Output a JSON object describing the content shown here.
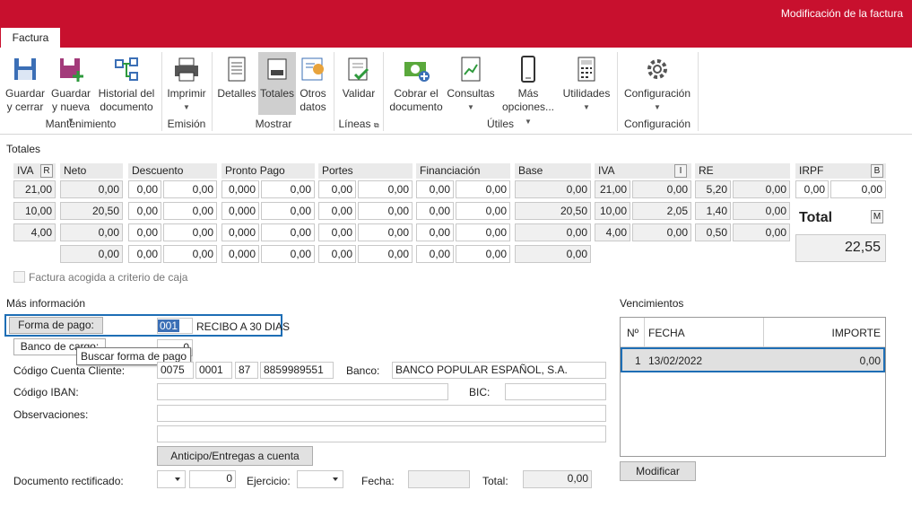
{
  "window": {
    "title": "Modificación de la factura",
    "tab": "Factura"
  },
  "ribbon": {
    "guardar": "Guardar\ny cerrar",
    "guardar_nueva": "Guardar\ny nueva",
    "historial": "Historial del\ndocumento",
    "imprimir": "Imprimir",
    "detalles": "Detalles",
    "totales": "Totales",
    "otros": "Otros\ndatos",
    "validar": "Validar",
    "cobrar": "Cobrar el\ndocumento",
    "consultas": "Consultas",
    "mas": "Más\nopciones...",
    "utilidades": "Utilidades",
    "configuracion": "Configuración",
    "groups": {
      "mantenimiento": "Mantenimiento",
      "emision": "Emisión",
      "mostrar": "Mostrar",
      "lineas": "Líneas",
      "utiles": "Útiles",
      "configuracion": "Configuración"
    }
  },
  "totales": {
    "section": "Totales",
    "headers": {
      "iva": "IVA",
      "r": "R",
      "neto": "Neto",
      "descuento": "Descuento",
      "pronto": "Pronto Pago",
      "portes": "Portes",
      "financiacion": "Financiación",
      "base": "Base",
      "iva2": "IVA",
      "i": "I",
      "re": "RE",
      "irpf": "IRPF",
      "b": "B",
      "m": "M"
    },
    "rows": [
      {
        "iva": "21,00",
        "neto": "0,00",
        "d1": "0,00",
        "d2": "0,00",
        "p1": "0,000",
        "p2": "0,00",
        "po1": "0,00",
        "po2": "0,00",
        "f1": "0,00",
        "f2": "0,00",
        "base": "0,00",
        "iv1": "21,00",
        "iv2": "0,00",
        "re1": "5,20",
        "re2": "0,00"
      },
      {
        "iva": "10,00",
        "neto": "20,50",
        "d1": "0,00",
        "d2": "0,00",
        "p1": "0,000",
        "p2": "0,00",
        "po1": "0,00",
        "po2": "0,00",
        "f1": "0,00",
        "f2": "0,00",
        "base": "20,50",
        "iv1": "10,00",
        "iv2": "2,05",
        "re1": "1,40",
        "re2": "0,00"
      },
      {
        "iva": "4,00",
        "neto": "0,00",
        "d1": "0,00",
        "d2": "0,00",
        "p1": "0,000",
        "p2": "0,00",
        "po1": "0,00",
        "po2": "0,00",
        "f1": "0,00",
        "f2": "0,00",
        "base": "0,00",
        "iv1": "4,00",
        "iv2": "0,00",
        "re1": "0,50",
        "re2": "0,00"
      },
      {
        "iva": "",
        "neto": "0,00",
        "d1": "0,00",
        "d2": "0,00",
        "p1": "0,000",
        "p2": "0,00",
        "po1": "0,00",
        "po2": "0,00",
        "f1": "0,00",
        "f2": "0,00",
        "base": "0,00"
      }
    ],
    "irpf1": "0,00",
    "irpf2": "0,00",
    "total_label": "Total",
    "total": "22,55",
    "caja": "Factura acogida a criterio de caja"
  },
  "info": {
    "section": "Más información",
    "forma_pago_btn": "Forma de pago:",
    "forma_pago_code": "001",
    "forma_pago_desc": "RECIBO A 30 DIAS",
    "banco_cargo_btn": "Banco de cargo:",
    "banco_cargo_val": "0",
    "tooltip": "Buscar forma de pago",
    "ccc_label": "Código Cuenta Cliente:",
    "ccc1": "0075",
    "ccc2": "0001",
    "ccc3": "87",
    "ccc4": "8859989551",
    "banco_label": "Banco:",
    "banco": "BANCO POPULAR ESPAÑOL, S.A.",
    "iban_label": "Código IBAN:",
    "bic_label": "BIC:",
    "obs_label": "Observaciones:",
    "anticipo_btn": "Anticipo/Entregas a cuenta",
    "doc_rect_label": "Documento rectificado:",
    "doc_rect_num": "0",
    "ejercicio_label": "Ejercicio:",
    "fecha_label": "Fecha:",
    "total_label": "Total:",
    "total": "0,00"
  },
  "vencimientos": {
    "section": "Vencimientos",
    "cols": [
      "Nº",
      "FECHA",
      "IMPORTE"
    ],
    "rows": [
      {
        "n": "1",
        "fecha": "13/02/2022",
        "importe": "0,00"
      }
    ],
    "modificar": "Modificar"
  }
}
